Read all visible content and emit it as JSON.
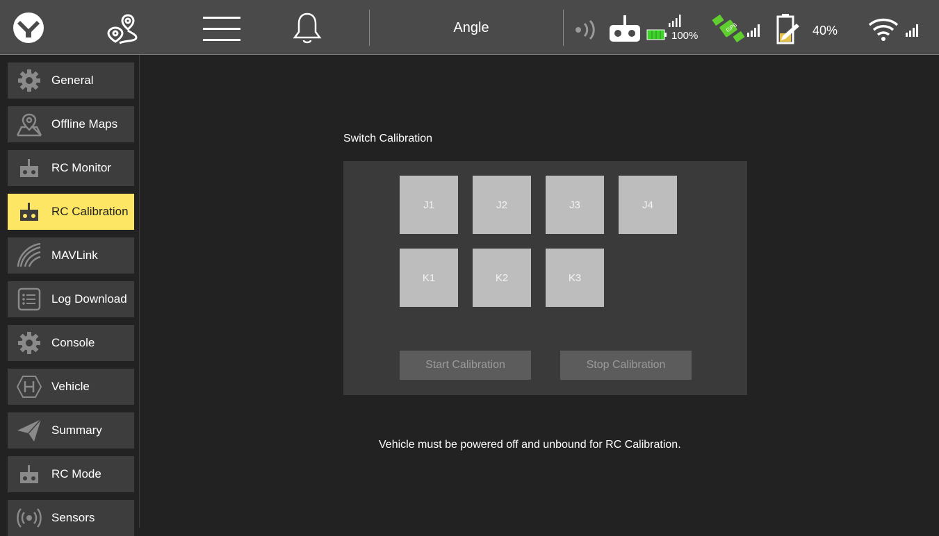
{
  "toolbar": {
    "flight_mode": "Angle",
    "rc_signal_percent": "100%",
    "battery_percent": "40%",
    "icons": [
      "app-logo-icon",
      "route-plan-icon",
      "menu-icon",
      "bell-icon",
      "signal-icon",
      "rc-controller-icon",
      "rc-battery-icon",
      "rc-rssi-icon",
      "gps-icon",
      "gps-bars-icon",
      "vehicle-battery-icon",
      "wifi-icon",
      "wifi-bars-icon"
    ]
  },
  "sidebar": {
    "items": [
      {
        "label": "General",
        "icon": "gear-icon"
      },
      {
        "label": "Offline Maps",
        "icon": "map-pin-icon"
      },
      {
        "label": "RC Monitor",
        "icon": "rc-controller-icon"
      },
      {
        "label": "RC Calibration",
        "icon": "rc-controller-icon",
        "active": true
      },
      {
        "label": "MAVLink",
        "icon": "mavlink-waves-icon"
      },
      {
        "label": "Log Download",
        "icon": "list-icon"
      },
      {
        "label": "Console",
        "icon": "gear-icon"
      },
      {
        "label": "Vehicle",
        "icon": "hexagon-h-icon"
      },
      {
        "label": "Summary",
        "icon": "paper-plane-icon"
      },
      {
        "label": "RC Mode",
        "icon": "rc-controller-icon"
      },
      {
        "label": "Sensors",
        "icon": "sensor-icon"
      }
    ]
  },
  "main": {
    "section_title": "Switch Calibration",
    "switches_row1": [
      "J1",
      "J2",
      "J3",
      "J4"
    ],
    "switches_row2": [
      "K1",
      "K2",
      "K3"
    ],
    "start_label": "Start Calibration",
    "stop_label": "Stop Calibration",
    "message": "Vehicle must be powered off and unbound for RC Calibration."
  },
  "colors": {
    "background": "#222222",
    "toolbar": "#4a4a4a",
    "nav_button": "#3d3d3d",
    "nav_active": "#fde663",
    "panel": "#3a3a3a",
    "switch_box": "#bdbdbd",
    "button": "#5c5c5c",
    "gps_green": "#5fce2e",
    "battery_green": "#3fd12c",
    "battery_yellow": "#e4c34a"
  }
}
